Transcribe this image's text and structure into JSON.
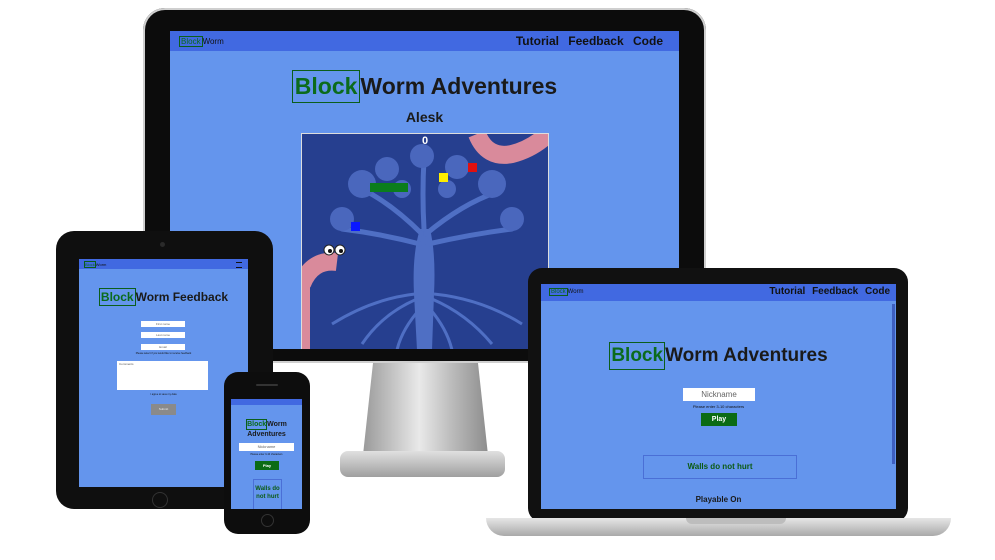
{
  "desktop": {
    "nav": {
      "logo_block": "Block",
      "logo_worm": "Worm",
      "links": [
        "Tutorial",
        "Feedback",
        "Code"
      ]
    },
    "title_block": "Block",
    "title_rest": "Worm Adventures",
    "player": "Alesk",
    "score": "0"
  },
  "laptop": {
    "nav": {
      "logo_block": "Block",
      "logo_worm": "Worm",
      "links": [
        "Tutorial",
        "Feedback",
        "Code"
      ]
    },
    "title_block": "Block",
    "title_rest": "Worm Adventures",
    "nickname_placeholder": "Nickname",
    "hint": "Please enter 3-10 characters",
    "play_label": "Play",
    "walls_text": "Walls do not hurt",
    "playable_text": "Playable On"
  },
  "tablet": {
    "nav": {
      "logo_block": "Block",
      "logo_worm": "Worm"
    },
    "title_block": "Block",
    "title_rest": "Worm Feedback",
    "fields": [
      "First name",
      "Last name",
      "Email"
    ],
    "consent": "Please select if you would like to receive feedback",
    "comment_placeholder": "Comments",
    "check_label": "I agree to save my data",
    "submit_label": "Submit"
  },
  "phone": {
    "title_block": "Block",
    "title_rest": "Worm",
    "title_line2": "Adventures",
    "nickname_placeholder": "Nickname",
    "hint": "Please enter 3-10 characters",
    "play_label": "Play",
    "walls_text": "Walls do not hurt"
  },
  "colors": {
    "page_bg": "#6495ED",
    "nav_bg": "#4169E1",
    "brand_green": "#0B6B1C",
    "game_bg": "#263F8F",
    "worm": "#D98A9B"
  }
}
